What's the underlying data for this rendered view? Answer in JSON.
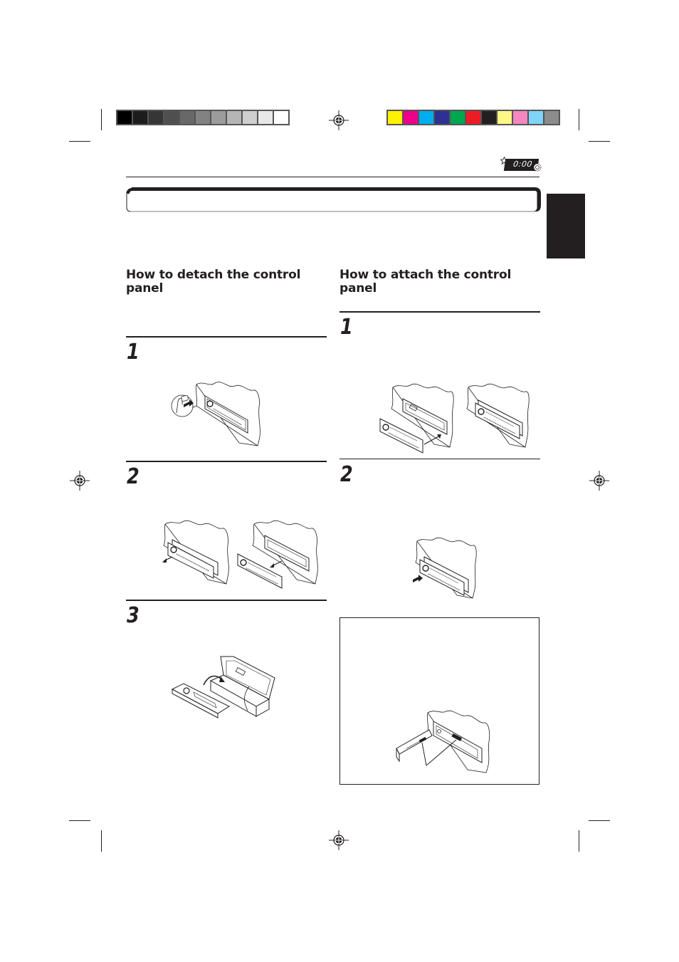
{
  "color_bars": {
    "grayscale": [
      "#000000",
      "#1c1c1c",
      "#363636",
      "#4f4f4f",
      "#686868",
      "#828282",
      "#9c9c9c",
      "#b5b5b5",
      "#cfcfcf",
      "#e8e8e8",
      "#ffffff"
    ],
    "process": [
      "#fff200",
      "#ec008c",
      "#00aeef",
      "#2e3192",
      "#00a651",
      "#ed1c24",
      "#231f20",
      "#fff685",
      "#f587c0",
      "#7fd4f7",
      "#8c8c8c"
    ]
  },
  "header": {
    "clock_icon_text": "0:00",
    "icons": [
      "star-icon",
      "clock-display-icon",
      "gear-icon"
    ]
  },
  "title_bar": {
    "text": ""
  },
  "side_tab": {
    "text": ""
  },
  "left_column": {
    "heading": "How to detach the control panel",
    "steps": [
      {
        "number": "1",
        "illustration": "press-release-button-illustration"
      },
      {
        "number": "2",
        "illustration": "pull-out-panel-illustration"
      },
      {
        "number": "3",
        "illustration": "put-panel-in-case-illustration"
      }
    ]
  },
  "right_column": {
    "heading": "How to attach the control panel",
    "steps": [
      {
        "number": "1",
        "illustration": "insert-panel-illustration"
      },
      {
        "number": "2",
        "illustration": "press-panel-in-illustration"
      }
    ],
    "note_box": {
      "illustration": "connector-terminals-illustration"
    }
  }
}
